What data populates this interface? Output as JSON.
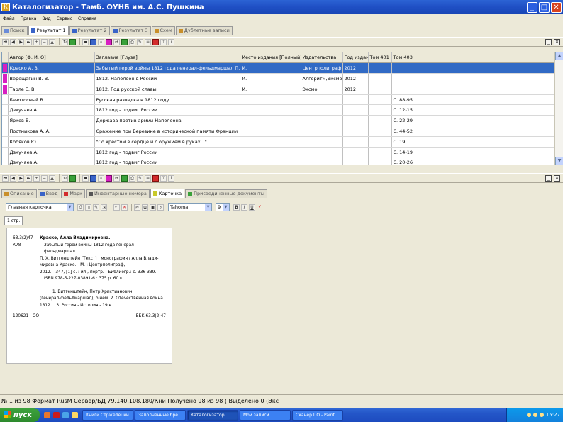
{
  "window": {
    "title": "Каталогизатор - Тамб. ОУНБ им. А.С. Пушкина"
  },
  "menu": [
    "Файл",
    "Правка",
    "Вид",
    "Сервис",
    "Справка"
  ],
  "top_tabs": [
    {
      "label": "Поиск",
      "active": false
    },
    {
      "label": "Результат 1",
      "active": true
    },
    {
      "label": "Результат 2",
      "active": false
    },
    {
      "label": "Результат 3",
      "active": false
    },
    {
      "label": "Схем",
      "active": false
    },
    {
      "label": "Дублетные записи",
      "active": false
    }
  ],
  "grid": {
    "columns": [
      "",
      "Автор [Ф. И. О]",
      "Заглавие [Глуза]",
      "Место издания [Полный]",
      "Издательства",
      "Год издан",
      "Том 401",
      "Том 403"
    ],
    "rows": [
      {
        "marked": true,
        "selected": true,
        "cells": [
          "Краско А. В.",
          "Забытый герой войны 1812 года генерал-фельдмаршал П.",
          "М.",
          "Центрполиграф",
          "2012",
          "",
          ""
        ]
      },
      {
        "marked": true,
        "selected": false,
        "cells": [
          "Верещагин В. В.",
          "1812. Наполеон в России",
          "М.",
          "Алгоритм,Эксмо",
          "2012",
          "",
          ""
        ]
      },
      {
        "marked": true,
        "selected": false,
        "cells": [
          "Тарле Е. В.",
          "1812. Год русской славы",
          "М.",
          "Эксмо",
          "2012",
          "",
          ""
        ]
      },
      {
        "marked": false,
        "selected": false,
        "cells": [
          "Безотосный В.",
          "Русская разведка в 1812 году",
          "",
          "",
          "",
          "",
          "С. 88-95"
        ]
      },
      {
        "marked": false,
        "selected": false,
        "cells": [
          "Дзкучаев А.",
          "1812 год - подвиг России",
          "",
          "",
          "",
          "",
          "С. 12-15"
        ]
      },
      {
        "marked": false,
        "selected": false,
        "cells": [
          "Ярков В.",
          "Держава против армии Наполеона",
          "",
          "",
          "",
          "",
          "С. 22-29"
        ]
      },
      {
        "marked": false,
        "selected": false,
        "cells": [
          "Постникова А. А.",
          "Сражение при Березине в исторической памяти Франции",
          "",
          "",
          "",
          "",
          "С. 44-52"
        ]
      },
      {
        "marked": false,
        "selected": false,
        "cells": [
          "Кобяков Ю.",
          "\"Со крестом в сердце и с оружием в руках...\"",
          "",
          "",
          "",
          "",
          "С. 19"
        ]
      },
      {
        "marked": false,
        "selected": false,
        "cells": [
          "Дзкучаев А.",
          "1812 год - подвиг России",
          "",
          "",
          "",
          "",
          "С. 14-19"
        ]
      },
      {
        "marked": false,
        "selected": false,
        "cells": [
          "Дзкучаев А.",
          "1812 год - подвиг России",
          "",
          "",
          "",
          "",
          "С. 20-26"
        ]
      }
    ]
  },
  "sub_tabs": [
    {
      "label": "Описание",
      "active": false
    },
    {
      "label": "Ввод",
      "active": false
    },
    {
      "label": "Марк",
      "active": false
    },
    {
      "label": "Инвентарные номера",
      "active": false
    },
    {
      "label": "Карточка",
      "active": true
    },
    {
      "label": "Присоединенные документы",
      "active": false
    }
  ],
  "format_toolbar": {
    "card_type": "Главная карточка",
    "font": "Tahoma",
    "size": "9",
    "bold": "B",
    "italic": "I",
    "underline": "U",
    "check": "✓"
  },
  "page_tab": "1 стр.",
  "card": {
    "call_number": "63.3(2)47",
    "call_number_2": "К78",
    "author": "Краско, Алла Владимировна.",
    "body_lines": [
      "Забытый герой войны 1812 года генерал-фельдмаршал",
      "П. Х. Витгенштейн [Текст] : монография / Алла Влади-",
      "мировна Краско. - М. : Центрполиграф,",
      "2012. - 347, [1] с. : ил., портр. - Библиогр.: с. 336-339.",
      "ISBN 978-5-227-03891-6 : 375 р. 60 к."
    ],
    "subject_lines": [
      "1. Витгенштейн, Петр Христианович",
      "(генерал-фельдмаршал), о нем. 2. Отечественная война",
      "1812 г. 3. Россия - История - 19 в."
    ],
    "footer_left": "120621 - ОО",
    "footer_right": "ББК 63.3(2)47"
  },
  "status": {
    "text": "№ 1 из 98 Формат RusM Сервер/БД 79.140.108.180/Кни Получено 98 из 98 ( Выделено 0 (Экс"
  },
  "taskbar": {
    "start_label": "пуск",
    "tasks": [
      {
        "label": "Книги Стржелецки...",
        "active": false
      },
      {
        "label": "Заполненные бре...",
        "active": false
      },
      {
        "label": "Каталогизатор",
        "active": true
      },
      {
        "label": "Мои записи",
        "active": false
      },
      {
        "label": "Сканер ПО - Paint",
        "active": false
      }
    ],
    "clock": "15:27"
  }
}
